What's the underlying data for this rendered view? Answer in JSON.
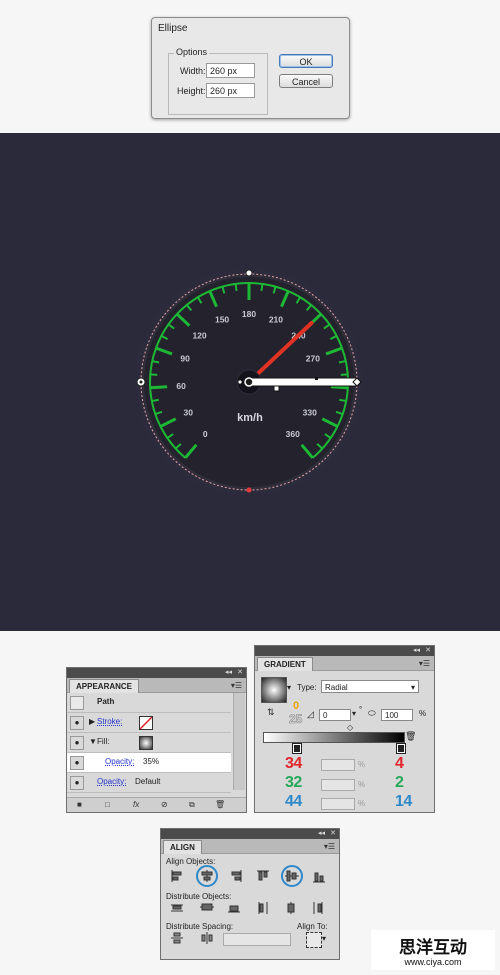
{
  "ellipse_dialog": {
    "title": "Ellipse",
    "group_label": "Options",
    "width_label": "Width:",
    "width_value": "260 px",
    "height_label": "Height:",
    "height_value": "260 px",
    "ok_label": "OK",
    "cancel_label": "Cancel"
  },
  "speedometer": {
    "tick_labels": [
      "0",
      "30",
      "60",
      "90",
      "120",
      "150",
      "180",
      "210",
      "240",
      "270",
      "330",
      "360"
    ],
    "unit_label": "km/h",
    "needle_value": 240,
    "colors": {
      "background": "#2b2a3a",
      "dial": "#23222d",
      "scale": "#1db935",
      "needle": "#e03324",
      "path_handle": "#ffffff"
    }
  },
  "appearance_panel": {
    "tab": "APPEARANCE",
    "rows": {
      "path": "Path",
      "stroke_label": "Stroke:",
      "fill_label": "Fill:",
      "fill_opacity_label": "Opacity:",
      "fill_opacity_value": "35%",
      "opacity_label": "Opacity:",
      "opacity_value": "Default"
    },
    "bottom_icons": [
      "new-art-icon",
      "clear-icon",
      "fx-icon",
      "reduce-icon",
      "duplicate-icon",
      "trash-icon"
    ]
  },
  "gradient_panel": {
    "tab": "GRADIENT",
    "type_label": "Type:",
    "type_value": "Radial",
    "angle_value": "0",
    "angle_unit": "°",
    "aspect_value": "100",
    "aspect_unit": "%",
    "annotation_top": "0",
    "annotation_25": "25",
    "left_stop": {
      "r": "34",
      "g": "32",
      "b": "44"
    },
    "right_stop": {
      "r": "4",
      "g": "2",
      "b": "14"
    },
    "percent_sign": "%",
    "colors": {
      "red": "#e0262c",
      "green": "#26a85a",
      "blue": "#2f89c9",
      "orange": "#f0a20a"
    }
  },
  "align_panel": {
    "tab": "ALIGN",
    "align_objects_label": "Align Objects:",
    "distribute_objects_label": "Distribute Objects:",
    "distribute_spacing_label": "Distribute Spacing:",
    "align_to_label": "Align To:"
  },
  "watermark": {
    "text": "思洋互动",
    "url": "www.ciya.com"
  }
}
